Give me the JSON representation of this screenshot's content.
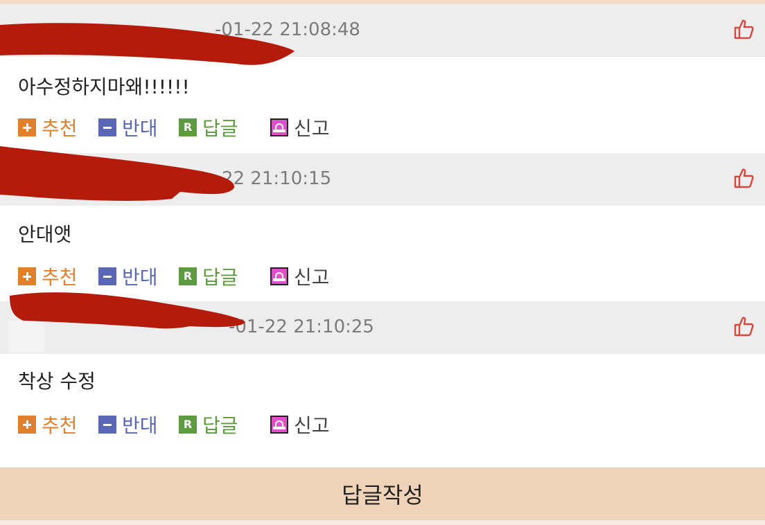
{
  "comments": [
    {
      "timestamp": "-01-22 21:08:48",
      "text": "아수정하지마왜!!!!!!",
      "actions": {
        "recommend": "추천",
        "oppose": "반대",
        "reply": "답글",
        "report": "신고"
      },
      "like_icon": "thumbs-up-icon"
    },
    {
      "timestamp": "22 21:10:15",
      "text": "안대앳",
      "actions": {
        "recommend": "추천",
        "oppose": "반대",
        "reply": "답글",
        "report": "신고"
      },
      "like_icon": "thumbs-up-icon"
    },
    {
      "timestamp": "-01-22 21:10:25",
      "text": "착상 수정",
      "actions": {
        "recommend": "추천",
        "oppose": "반대",
        "reply": "답글",
        "report": "신고"
      },
      "like_icon": "thumbs-up-icon"
    }
  ],
  "reply_icon_letter": "R",
  "write_button": "답글작성",
  "colors": {
    "recommend": "#e07f2c",
    "oppose": "#5a66b6",
    "reply": "#5e9b3f",
    "report_icon": "#e051c9",
    "like": "#d9463b",
    "header_bg": "#ededed",
    "write_bar_bg": "#efd3b8",
    "redaction": "#b51b0a"
  }
}
